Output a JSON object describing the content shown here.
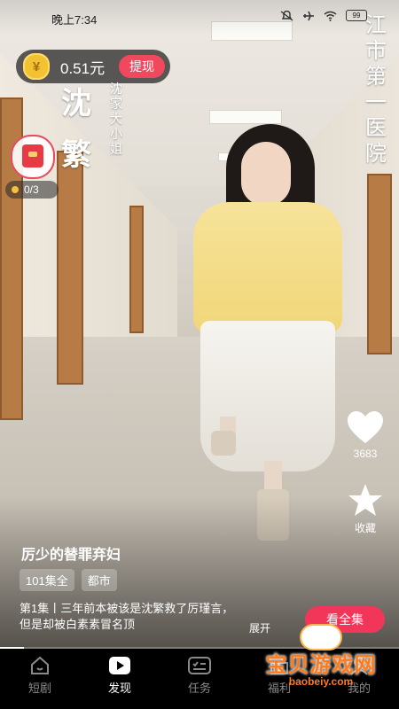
{
  "status_bar": {
    "time": "晚上7:34",
    "battery": "99"
  },
  "reward": {
    "amount": "0.51元",
    "withdraw_label": "提现",
    "coin_symbol": "¥"
  },
  "task_progress": "0/3",
  "overlay": {
    "character_name": [
      "沈",
      "繁"
    ],
    "character_role": [
      "沈",
      "家",
      "大",
      "小",
      "姐"
    ],
    "location": [
      "江",
      "市",
      "第",
      "一",
      "医",
      "院"
    ]
  },
  "actions": {
    "like_count": "3683",
    "favorite_label": "收藏"
  },
  "drama": {
    "title": "厉少的替罪弃妇",
    "tags": [
      "101集全",
      "都市"
    ],
    "description": "第1集丨三年前本被该是沈繁救了厉瑾言，但是却被白素素冒名顶",
    "expand_label": "展开",
    "watch_all_label": "看全集",
    "playback_progress": 0.06
  },
  "tabs": [
    {
      "label": "短剧",
      "icon": "house-icon",
      "active": false
    },
    {
      "label": "发现",
      "icon": "play-icon",
      "active": true
    },
    {
      "label": "任务",
      "icon": "task-icon",
      "active": false
    },
    {
      "label": "福利",
      "icon": "gift-icon",
      "active": false
    },
    {
      "label": "我的",
      "icon": "profile-icon",
      "active": false
    }
  ],
  "watermark": {
    "text": "宝贝游戏网",
    "url": "baobeiy.com"
  },
  "colors": {
    "accent": "#f2365a",
    "coin": "#f3c233",
    "tabbar": "#000000"
  }
}
